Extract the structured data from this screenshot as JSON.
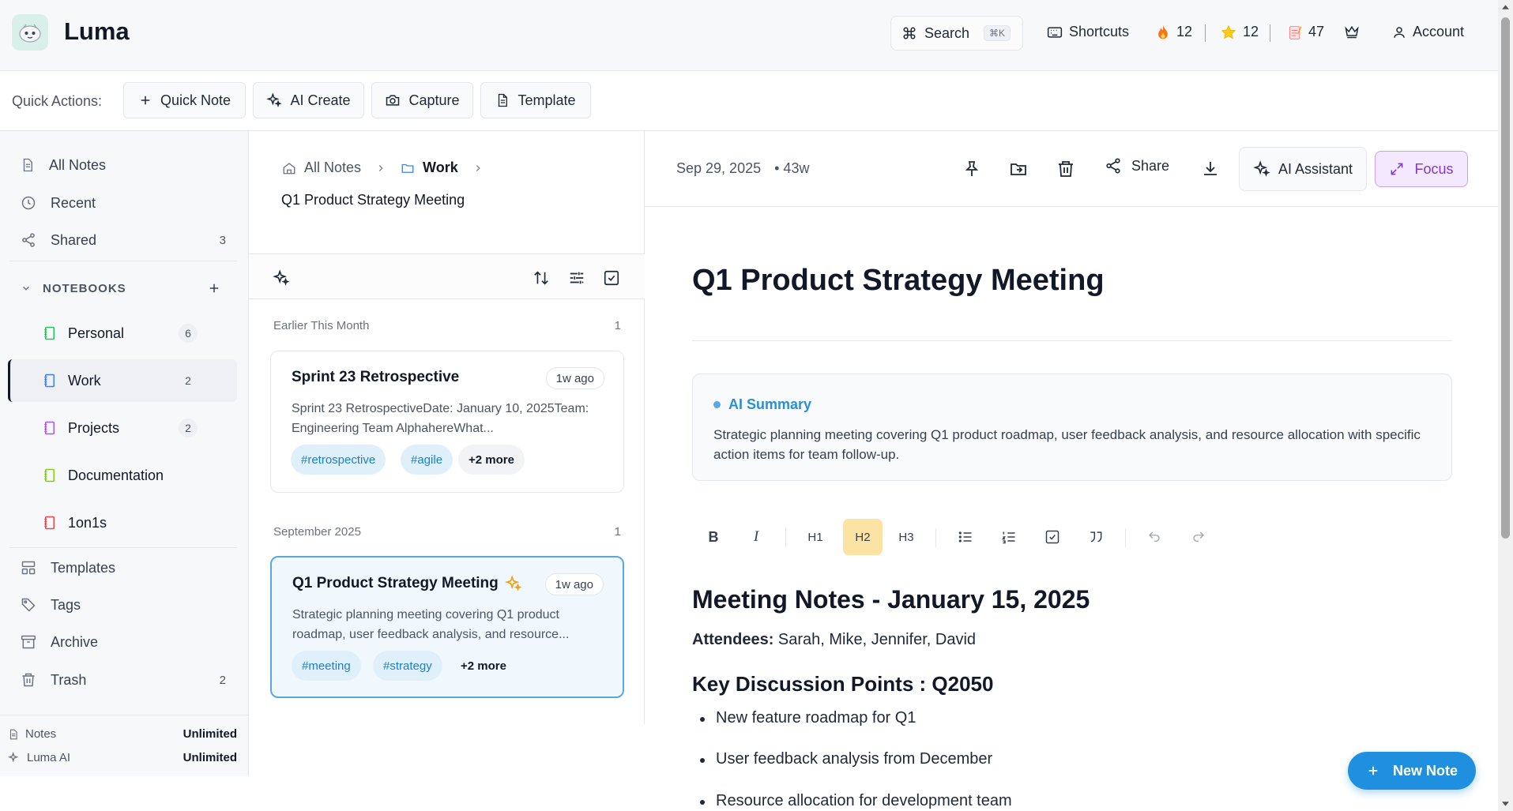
{
  "app": {
    "name": "Luma"
  },
  "header": {
    "search_label": "Search",
    "search_shortcut": "⌘K",
    "shortcuts_label": "Shortcuts",
    "streak_count": "12",
    "stars_count": "12",
    "notes_count": "47",
    "account_label": "Account"
  },
  "quick_actions": {
    "label": "Quick Actions:",
    "quick_note": "Quick Note",
    "ai_create": "AI Create",
    "capture": "Capture",
    "template": "Template"
  },
  "sidebar": {
    "all_notes": "All Notes",
    "recent": "Recent",
    "shared": "Shared",
    "shared_count": "3",
    "notebooks_heading": "NOTEBOOKS",
    "notebooks": [
      {
        "label": "Personal",
        "count": "6",
        "color": "#22c55e"
      },
      {
        "label": "Work",
        "count": "2",
        "color": "#3b82f6"
      },
      {
        "label": "Projects",
        "count": "2",
        "color": "#a855f7"
      },
      {
        "label": "Documentation",
        "count": "",
        "color": "#84cc16"
      },
      {
        "label": "1on1s",
        "count": "",
        "color": "#ef4444"
      }
    ],
    "templates": "Templates",
    "tags": "Tags",
    "archive": "Archive",
    "trash": "Trash",
    "trash_count": "2",
    "usage": [
      {
        "label": "Notes",
        "value": "Unlimited"
      },
      {
        "label": "Luma AI",
        "value": "Unlimited"
      }
    ]
  },
  "list": {
    "breadcrumb_root": "All Notes",
    "breadcrumb_folder": "Work",
    "breadcrumb_note": "Q1 Product Strategy Meeting",
    "groups": [
      {
        "label": "Earlier This Month",
        "count": "1",
        "note": {
          "title": "Sprint 23 Retrospective",
          "time": "1w ago",
          "snippet": "Sprint 23 RetrospectiveDate: January 10, 2025Team: Engineering Team AlphahereWhat...",
          "tags": [
            "#retrospective",
            "#agile"
          ],
          "more": "+2 more"
        }
      },
      {
        "label": "September 2025",
        "count": "1",
        "note": {
          "title": "Q1 Product Strategy Meeting",
          "time": "1w ago",
          "snippet": "Strategic planning meeting covering Q1 product roadmap, user feedback analysis, and resource...",
          "tags": [
            "#meeting",
            "#strategy"
          ],
          "more": "+2 more"
        }
      }
    ]
  },
  "editor": {
    "date": "Sep 29, 2025",
    "age": "• 43w",
    "share_label": "Share",
    "ai_assistant_label": "AI Assistant",
    "focus_label": "Focus",
    "title": "Q1 Product Strategy Meeting",
    "ai_summary_heading": "AI Summary",
    "ai_summary_text": "Strategic planning meeting covering Q1 product roadmap, user feedback analysis, and resource allocation with specific action items for team follow-up.",
    "format_buttons": [
      "B",
      "I",
      "H1",
      "H2",
      "H3"
    ],
    "content": {
      "h1": "Meeting Notes - January 15, 2025",
      "attendees_label": "Attendees:",
      "attendees": " Sarah, Mike, Jennifer, David",
      "h2": "Key Discussion Points : Q2050",
      "bullets": [
        "New feature roadmap for Q1",
        "User feedback analysis from December",
        "Resource allocation for development team"
      ]
    }
  },
  "fab": {
    "new_note_label": "New Note"
  },
  "colors": {
    "accent": "#1e90df",
    "focus": "#7e3bc9",
    "h2_active": "#fbe3a3"
  }
}
